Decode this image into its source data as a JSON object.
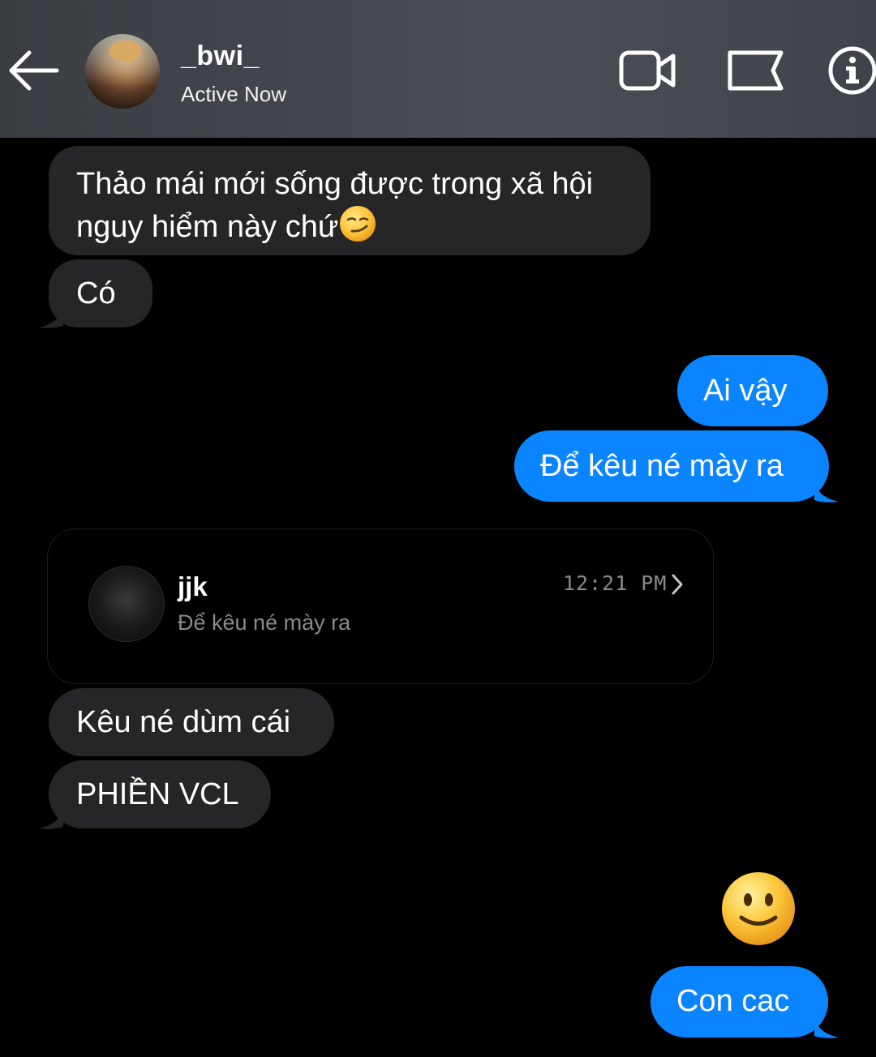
{
  "header": {
    "username": "_bwi_",
    "status": "Active Now",
    "icons": [
      "back-arrow-icon",
      "video-call-icon",
      "flag-icon",
      "info-icon"
    ]
  },
  "messages": [
    {
      "direction": "incoming",
      "text": "Thảo mái mới sống được trong xã hội nguy hiểm này chứ",
      "emoji": "smirk"
    },
    {
      "direction": "incoming",
      "text": "Có"
    },
    {
      "direction": "outgoing",
      "text": "Ai vậy"
    },
    {
      "direction": "outgoing",
      "text": "Để kêu né mày ra"
    },
    {
      "direction": "incoming",
      "text": "Kêu né dùm cái"
    },
    {
      "direction": "incoming",
      "text": "PHIỀN VCL"
    },
    {
      "direction": "outgoing",
      "emoji": "slightly-smiling-face"
    },
    {
      "direction": "outgoing",
      "text": "Con cac"
    }
  ],
  "shared_message": {
    "name": "jjk",
    "preview": "Để kêu né mày ra",
    "time": "12:21 PM"
  },
  "colors": {
    "incoming_bubble": "#262628",
    "outgoing_bubble": "#0a84ff",
    "background": "#000000"
  }
}
